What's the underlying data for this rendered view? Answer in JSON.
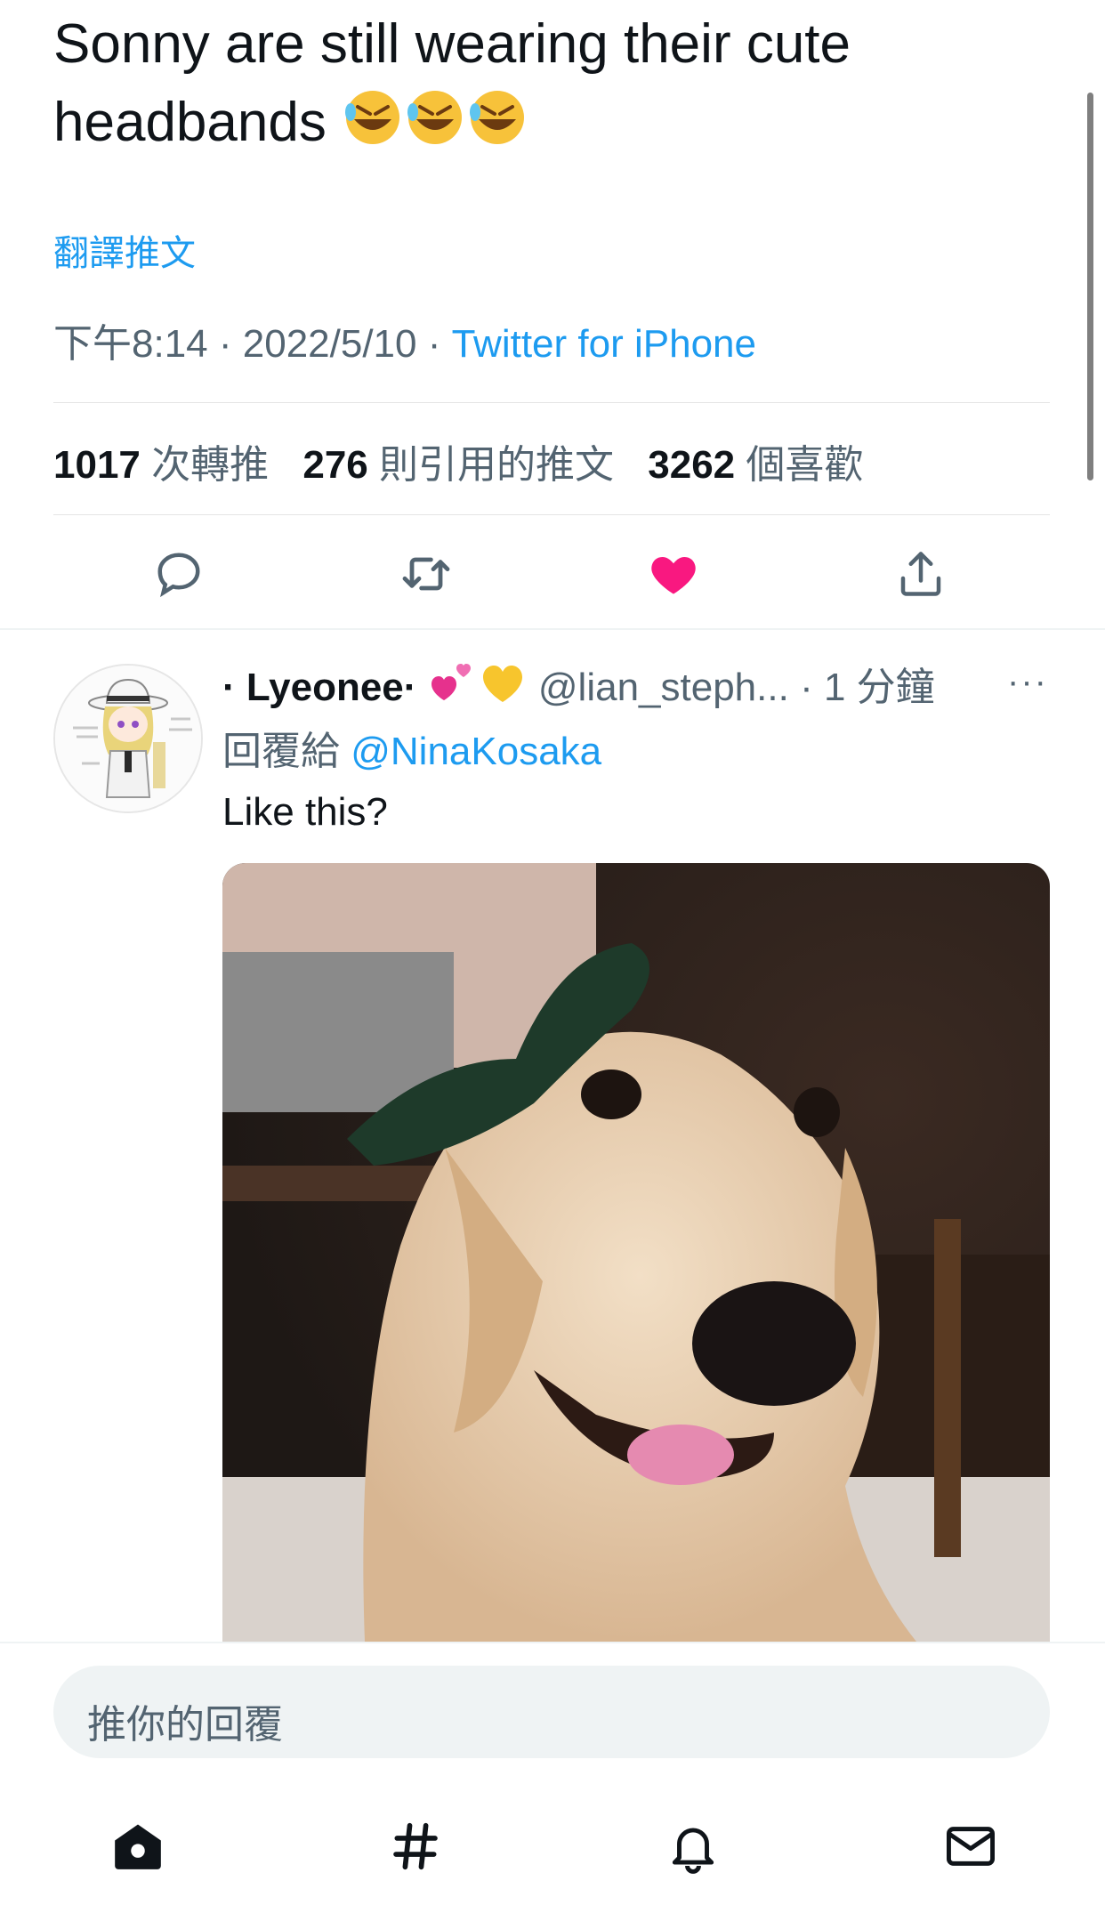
{
  "tweet": {
    "text": "Sonny are still wearing their cute headbands",
    "emojis": [
      "rofl",
      "rofl",
      "rofl"
    ],
    "translate_label": "翻譯推文",
    "time": "下午8:14",
    "date": "2022/5/10",
    "separator": " · ",
    "source": "Twitter for iPhone"
  },
  "stats": {
    "retweets": {
      "count": "1017",
      "label": "次轉推"
    },
    "quotes": {
      "count": "276",
      "label": "則引用的推文"
    },
    "likes": {
      "count": "3262",
      "label": "個喜歡"
    }
  },
  "actions": [
    {
      "icon": "reply-icon"
    },
    {
      "icon": "retweet-icon"
    },
    {
      "icon": "heart-filled-icon",
      "color": "#f91880"
    },
    {
      "icon": "share-icon"
    }
  ],
  "reply": {
    "name": "· Lyeonee·",
    "badges": [
      "two-hearts",
      "yellow-heart"
    ],
    "handle": "@lian_steph...",
    "time_sep": " · ",
    "time": "1 分鐘",
    "more": "···",
    "replying_label": "回覆給",
    "mention": "@NinaKosaka",
    "text": "Like this?"
  },
  "composer": {
    "placeholder": "推你的回覆"
  },
  "bottom_nav": [
    "home-icon",
    "explore-icon",
    "notifications-icon",
    "messages-icon"
  ],
  "colors": {
    "accent": "#1d9bf0",
    "like": "#f91880",
    "secondary_text": "#536471"
  }
}
